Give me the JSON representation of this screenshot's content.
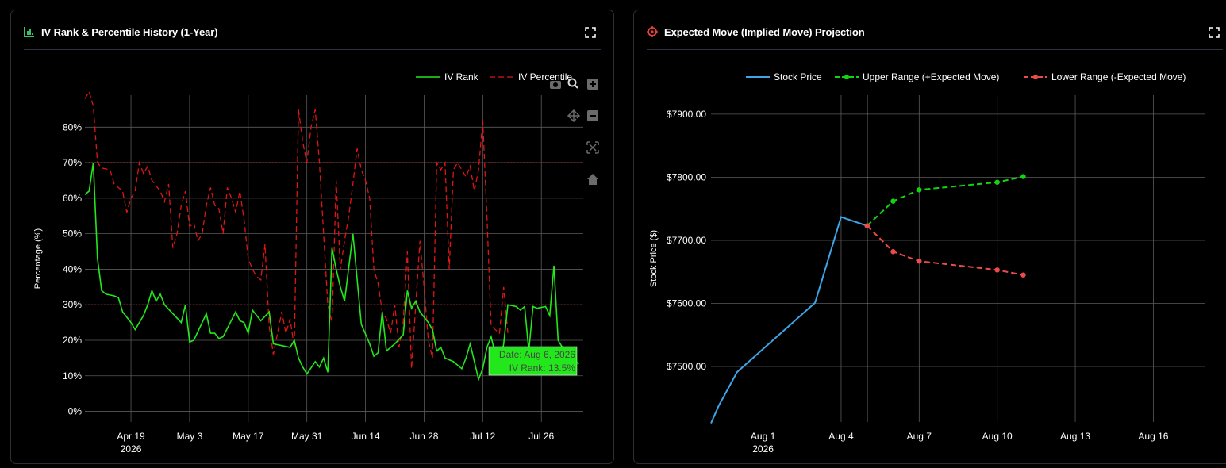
{
  "colors": {
    "background": "#000000",
    "panel_border": "#2e2f36",
    "iv_rank": "#22e81b",
    "iv_percentile": "#e01515",
    "reference_line": "#ff4040",
    "stock_price": "#3da5e8",
    "upper_range": "#11d511",
    "lower_range": "#ef4a4a",
    "title_icon_left": "#34c36a",
    "title_icon_right": "#e8413a"
  },
  "left_panel": {
    "title": "IV Rank & Percentile History (1-Year)",
    "title_icon": "chart-bar-icon",
    "expand_icon": "expand-icon",
    "modebar": [
      "camera-icon",
      "zoom-icon",
      "zoom-in-icon",
      "pan-icon",
      "zoom-out-icon",
      "autoscale-icon",
      "reset-axes-icon"
    ],
    "hover_tooltip": {
      "line1": "Date: Aug 6, 2026",
      "line2": "IV Rank: 13.5%"
    }
  },
  "right_panel": {
    "title": "Expected Move (Implied Move) Projection",
    "title_icon": "crosshair-icon",
    "expand_icon": "expand-icon"
  },
  "chart_data": [
    {
      "type": "line",
      "title": "IV Rank & Percentile History (1-Year)",
      "ylabel": "Percentage (%)",
      "xlabel": "",
      "x_ticks": [
        {
          "label": "Apr 19",
          "day": 0,
          "year": "2026"
        },
        {
          "label": "May 3",
          "day": 14
        },
        {
          "label": "May 17",
          "day": 28
        },
        {
          "label": "May 31",
          "day": 42
        },
        {
          "label": "Jun 14",
          "day": 56
        },
        {
          "label": "Jun 28",
          "day": 70
        },
        {
          "label": "Jul 12",
          "day": 84
        },
        {
          "label": "Jul 26",
          "day": 98
        }
      ],
      "x_range": [
        -11,
        108
      ],
      "y_ticks": [
        "0%",
        "10%",
        "20%",
        "30%",
        "40%",
        "50%",
        "60%",
        "70%",
        "80%"
      ],
      "ylim": [
        -3,
        89
      ],
      "grid": true,
      "legend_position": "top-right",
      "reference_lines": [
        70,
        30
      ],
      "series": [
        {
          "name": "IV Rank",
          "style": "solid",
          "points": [
            [
              -11,
              61
            ],
            [
              -10,
              62
            ],
            [
              -9,
              70
            ],
            [
              -8,
              43
            ],
            [
              -7,
              34
            ],
            [
              -6,
              33
            ],
            [
              -4,
              32.5
            ],
            [
              -3,
              32
            ],
            [
              -2,
              28
            ],
            [
              0,
              25
            ],
            [
              1,
              23
            ],
            [
              3,
              27
            ],
            [
              4,
              30
            ],
            [
              5,
              34
            ],
            [
              6,
              31
            ],
            [
              7,
              33
            ],
            [
              8,
              30
            ],
            [
              10,
              27.5
            ],
            [
              12,
              25
            ],
            [
              13,
              30
            ],
            [
              14,
              19.5
            ],
            [
              15,
              20
            ],
            [
              18,
              27.5
            ],
            [
              19,
              22
            ],
            [
              20,
              22
            ],
            [
              21,
              20.5
            ],
            [
              22,
              21
            ],
            [
              25,
              28
            ],
            [
              26,
              25.5
            ],
            [
              27,
              25
            ],
            [
              28,
              22
            ],
            [
              29,
              28.5
            ],
            [
              31,
              25.5
            ],
            [
              33,
              28
            ],
            [
              34,
              19
            ],
            [
              36,
              18.5
            ],
            [
              38,
              18
            ],
            [
              39,
              20
            ],
            [
              40,
              15
            ],
            [
              41,
              12.5
            ],
            [
              42,
              10.5
            ],
            [
              44,
              14
            ],
            [
              45,
              12.5
            ],
            [
              46,
              15
            ],
            [
              47,
              11
            ],
            [
              48,
              46
            ],
            [
              49,
              40
            ],
            [
              50,
              35
            ],
            [
              51,
              31
            ],
            [
              53,
              50
            ],
            [
              55,
              24.5
            ],
            [
              57,
              19
            ],
            [
              58,
              15.5
            ],
            [
              59,
              16.5
            ],
            [
              60,
              28
            ],
            [
              61,
              17
            ],
            [
              62,
              18
            ],
            [
              63,
              19
            ],
            [
              65,
              21.5
            ],
            [
              66,
              34
            ],
            [
              67,
              29
            ],
            [
              68,
              31
            ],
            [
              69,
              28
            ],
            [
              71,
              25
            ],
            [
              72,
              23
            ],
            [
              73,
              17
            ],
            [
              74,
              18
            ],
            [
              75,
              15
            ],
            [
              77,
              14
            ],
            [
              79,
              12
            ],
            [
              80,
              15
            ],
            [
              81,
              19
            ],
            [
              82,
              14
            ],
            [
              83,
              9
            ],
            [
              84,
              12
            ],
            [
              85,
              18
            ],
            [
              86,
              21
            ],
            [
              87,
              16
            ],
            [
              88,
              12.5
            ],
            [
              89,
              19
            ],
            [
              90,
              30
            ],
            [
              92,
              29.5
            ],
            [
              93,
              28.5
            ],
            [
              94,
              29.5
            ],
            [
              95,
              17
            ],
            [
              96,
              29.5
            ],
            [
              97,
              29
            ],
            [
              99,
              29.5
            ],
            [
              100,
              27
            ],
            [
              101,
              41
            ],
            [
              102,
              20
            ],
            [
              103,
              18
            ],
            [
              104,
              16
            ],
            [
              105,
              15
            ],
            [
              106,
              14
            ],
            [
              107,
              13.5
            ]
          ]
        },
        {
          "name": "IV Percentile",
          "style": "dashed",
          "points": [
            [
              -11,
              88
            ],
            [
              -10,
              90
            ],
            [
              -9,
              86
            ],
            [
              -8,
              70
            ],
            [
              -7,
              68.5
            ],
            [
              -5,
              68
            ],
            [
              -4,
              64
            ],
            [
              -2,
              62
            ],
            [
              -1,
              56
            ],
            [
              0,
              60
            ],
            [
              1,
              62
            ],
            [
              2,
              70
            ],
            [
              3,
              67
            ],
            [
              4,
              69
            ],
            [
              5,
              65
            ],
            [
              7,
              62
            ],
            [
              8,
              59
            ],
            [
              9,
              64
            ],
            [
              10,
              46
            ],
            [
              11,
              50
            ],
            [
              12,
              58
            ],
            [
              13,
              62
            ],
            [
              14,
              52
            ],
            [
              15,
              53
            ],
            [
              16,
              48
            ],
            [
              17,
              50
            ],
            [
              18,
              58
            ],
            [
              19,
              63
            ],
            [
              20,
              58
            ],
            [
              21,
              57
            ],
            [
              22,
              50
            ],
            [
              23,
              63
            ],
            [
              24,
              60
            ],
            [
              25,
              56
            ],
            [
              26,
              62
            ],
            [
              27,
              54
            ],
            [
              28,
              43
            ],
            [
              29,
              40
            ],
            [
              30,
              38
            ],
            [
              31,
              37
            ],
            [
              32,
              47
            ],
            [
              33,
              24
            ],
            [
              34,
              16
            ],
            [
              35,
              22
            ],
            [
              36,
              28
            ],
            [
              37,
              22
            ],
            [
              38,
              26
            ],
            [
              39,
              18
            ],
            [
              40,
              85
            ],
            [
              41,
              76
            ],
            [
              42,
              70
            ],
            [
              43,
              80
            ],
            [
              44,
              85
            ],
            [
              45,
              70
            ],
            [
              46,
              50
            ],
            [
              47,
              30
            ],
            [
              48,
              25
            ],
            [
              49,
              65
            ],
            [
              50,
              40
            ],
            [
              51,
              48
            ],
            [
              52,
              55
            ],
            [
              53,
              64
            ],
            [
              54,
              74
            ],
            [
              55,
              68
            ],
            [
              56,
              65
            ],
            [
              57,
              60
            ],
            [
              58,
              40
            ],
            [
              59,
              36
            ],
            [
              60,
              28
            ],
            [
              61,
              26
            ],
            [
              62,
              22
            ],
            [
              63,
              30
            ],
            [
              64,
              18
            ],
            [
              65,
              25
            ],
            [
              66,
              45
            ],
            [
              67,
              12
            ],
            [
              68,
              30
            ],
            [
              69,
              48
            ],
            [
              70,
              35
            ],
            [
              71,
              20
            ],
            [
              72,
              15
            ],
            [
              73,
              70
            ],
            [
              74,
              68
            ],
            [
              75,
              70
            ],
            [
              76,
              40
            ],
            [
              77,
              68
            ],
            [
              78,
              70
            ],
            [
              79,
              68
            ],
            [
              80,
              66
            ],
            [
              81,
              69
            ],
            [
              82,
              62
            ],
            [
              83,
              68
            ],
            [
              84,
              82
            ],
            [
              85,
              55
            ],
            [
              86,
              24
            ],
            [
              87,
              23
            ],
            [
              88,
              22
            ],
            [
              89,
              35
            ],
            [
              90,
              22
            ]
          ]
        }
      ]
    },
    {
      "type": "line",
      "title": "Expected Move (Implied Move) Projection",
      "ylabel": "Stock Price ($)",
      "xlabel": "",
      "x_ticks": [
        {
          "label": "Aug 1",
          "day": 1,
          "year": "2026"
        },
        {
          "label": "Aug 4",
          "day": 4
        },
        {
          "label": "Aug 7",
          "day": 7
        },
        {
          "label": "Aug 10",
          "day": 10
        },
        {
          "label": "Aug 13",
          "day": 13
        },
        {
          "label": "Aug 16",
          "day": 16
        }
      ],
      "x_range": [
        -1,
        18
      ],
      "y_ticks": [
        "$7500.00",
        "$7600.00",
        "$7700.00",
        "$7800.00",
        "$7900.00"
      ],
      "y_tick_values": [
        7500,
        7600,
        7700,
        7800,
        7900
      ],
      "ylim": [
        7412,
        7930
      ],
      "grid": true,
      "legend_position": "top",
      "vertical_marker_day": 5,
      "series": [
        {
          "name": "Stock Price",
          "style": "solid",
          "markers": false,
          "points": [
            [
              -1,
              7410
            ],
            [
              -0.7,
              7438
            ],
            [
              0,
              7491
            ],
            [
              3,
              7601
            ],
            [
              4,
              7737
            ],
            [
              5,
              7723
            ]
          ]
        },
        {
          "name": "Upper Range (+Expected Move)",
          "style": "dashed",
          "markers": true,
          "points": [
            [
              5,
              7723
            ],
            [
              6,
              7762
            ],
            [
              7,
              7780
            ],
            [
              10,
              7792
            ],
            [
              11,
              7801
            ]
          ]
        },
        {
          "name": "Lower Range (-Expected Move)",
          "style": "dashed",
          "markers": true,
          "points": [
            [
              5,
              7723
            ],
            [
              6,
              7682
            ],
            [
              7,
              7667
            ],
            [
              10,
              7653
            ],
            [
              11,
              7645
            ]
          ]
        }
      ]
    }
  ]
}
